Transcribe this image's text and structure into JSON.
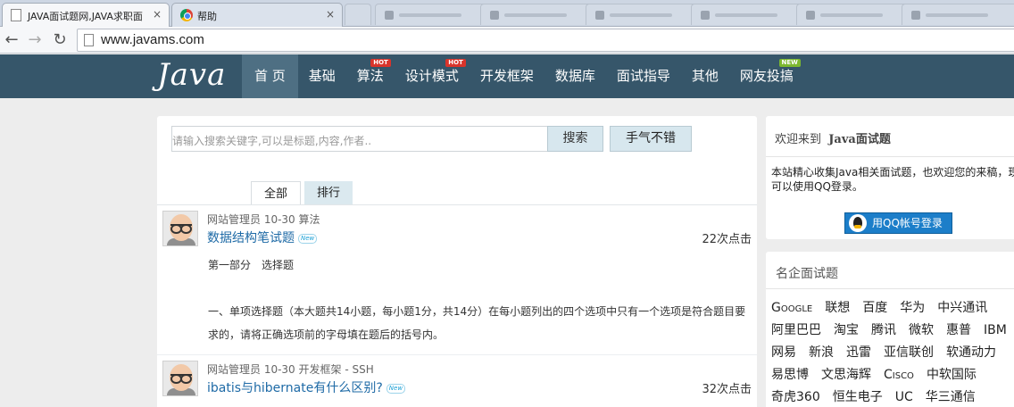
{
  "browser": {
    "tabs": [
      {
        "title": "JAVA面试题网,JAVA求职面"
      },
      {
        "title": "帮助"
      }
    ],
    "url": "www.javams.com",
    "close_glyph": "×"
  },
  "site": {
    "logo": "Java",
    "nav": [
      {
        "label": "首 页"
      },
      {
        "label": "基础"
      },
      {
        "label": "算法",
        "badge": "HOT"
      },
      {
        "label": "设计模式",
        "badge": "HOT"
      },
      {
        "label": "开发框架"
      },
      {
        "label": "数据库"
      },
      {
        "label": "面试指导"
      },
      {
        "label": "其他"
      },
      {
        "label": "网友投搞",
        "badge": "NEW"
      }
    ]
  },
  "search": {
    "placeholder": "请输入搜索关键字,可以是标题,内容,作者..",
    "search_label": "搜索",
    "lucky_label": "手气不错"
  },
  "tabs": {
    "all": "全部",
    "rank": "排行"
  },
  "posts": [
    {
      "meta": "网站管理员 10-30 算法",
      "title": "数据结构笔试题",
      "new_tag": "New",
      "clicks": "22次点击",
      "excerpt": [
        "第一部分　选择题",
        "一、单项选择题（本大题共14小题，每小题1分，共14分）在每小题列出的四个选项中只有一个选项是符合题目要求的，请将正确选项前的字母填在题后的括号内。"
      ]
    },
    {
      "meta": "网站管理员 10-30 开发框架 - SSH",
      "title": "ibatis与hibernate有什么区别?",
      "new_tag": "New",
      "clicks": "32次点击"
    }
  ],
  "sidebar": {
    "welcome_prefix": "欢迎来到",
    "welcome_name": "Java面试题",
    "welcome_text": "本站精心收集Java相关面试题，也欢迎您的来稿，现在可以使用QQ登录。",
    "qq_login": "用QQ帐号登录",
    "corp_title": "名企面试题",
    "corps": [
      [
        "Google",
        "联想",
        "百度",
        "华为",
        "中兴通讯"
      ],
      [
        "阿里巴巴",
        "淘宝",
        "腾讯",
        "微软",
        "惠普",
        "IBM"
      ],
      [
        "网易",
        "新浪",
        "迅雷",
        "亚信联创",
        "软通动力"
      ],
      [
        "易思博",
        "文思海辉",
        "Cisco",
        "中软国际"
      ],
      [
        "奇虎360",
        "恒生电子",
        "UC",
        "华三通信"
      ]
    ]
  },
  "colors": {
    "header_bg": "#36566a",
    "nav_active_bg": "#4e6f83",
    "link": "#1e6aa6",
    "hot_badge": "#d9342b",
    "new_badge": "#7cb82f"
  }
}
